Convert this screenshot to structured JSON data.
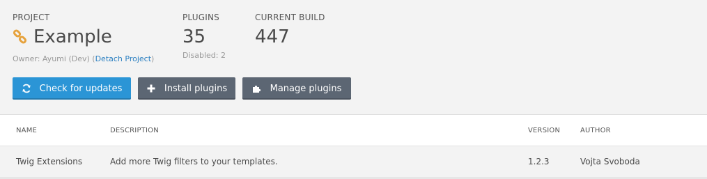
{
  "project": {
    "label": "PROJECT",
    "name": "Example",
    "owner_prefix": "Owner: Ayumi (Dev) (",
    "detach_link": "Detach Project",
    "owner_suffix": ")",
    "icon": "link-icon",
    "icon_color": "#e6a23c"
  },
  "plugins": {
    "label": "PLUGINS",
    "count": "35",
    "disabled": "Disabled: 2"
  },
  "build": {
    "label": "CURRENT BUILD",
    "number": "447"
  },
  "buttons": {
    "check_updates": "Check for updates",
    "install_plugins": "Install plugins",
    "manage_plugins": "Manage plugins",
    "primary_color": "#2b95d6",
    "secondary_color": "#5c6673"
  },
  "table": {
    "headers": {
      "name": "NAME",
      "description": "DESCRIPTION",
      "version": "VERSION",
      "author": "AUTHOR"
    },
    "rows": [
      {
        "name": "Twig Extensions",
        "description": "Add more Twig filters to your templates.",
        "version": "1.2.3",
        "author": "Vojta Svoboda"
      }
    ]
  }
}
